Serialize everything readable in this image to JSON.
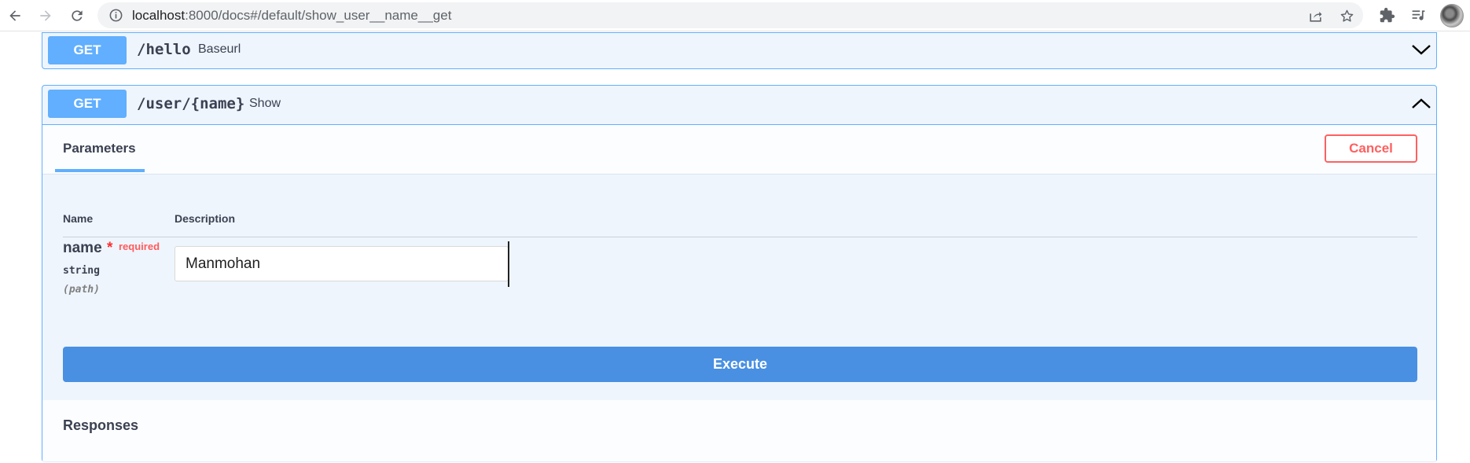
{
  "browser": {
    "url_host": "localhost",
    "url_path": ":8000/docs#/default/show_user__name__get"
  },
  "colors": {
    "get_method": "#61affe",
    "execute": "#4990e2",
    "cancel": "#ff6060",
    "required": "#ff2e2e"
  },
  "operations": [
    {
      "method": "GET",
      "path": "/hello",
      "description": "Baseurl",
      "expanded": false
    },
    {
      "method": "GET",
      "path": "/user/{name}",
      "description": "Show",
      "expanded": true,
      "parameters_tab": "Parameters",
      "cancel_label": "Cancel",
      "table_headers": {
        "name": "Name",
        "description": "Description"
      },
      "param": {
        "name": "name",
        "required_marker": "*",
        "required_label": "required",
        "type": "string",
        "location": "(path)",
        "value": "Manmohan"
      },
      "execute_label": "Execute",
      "responses_title": "Responses"
    }
  ]
}
